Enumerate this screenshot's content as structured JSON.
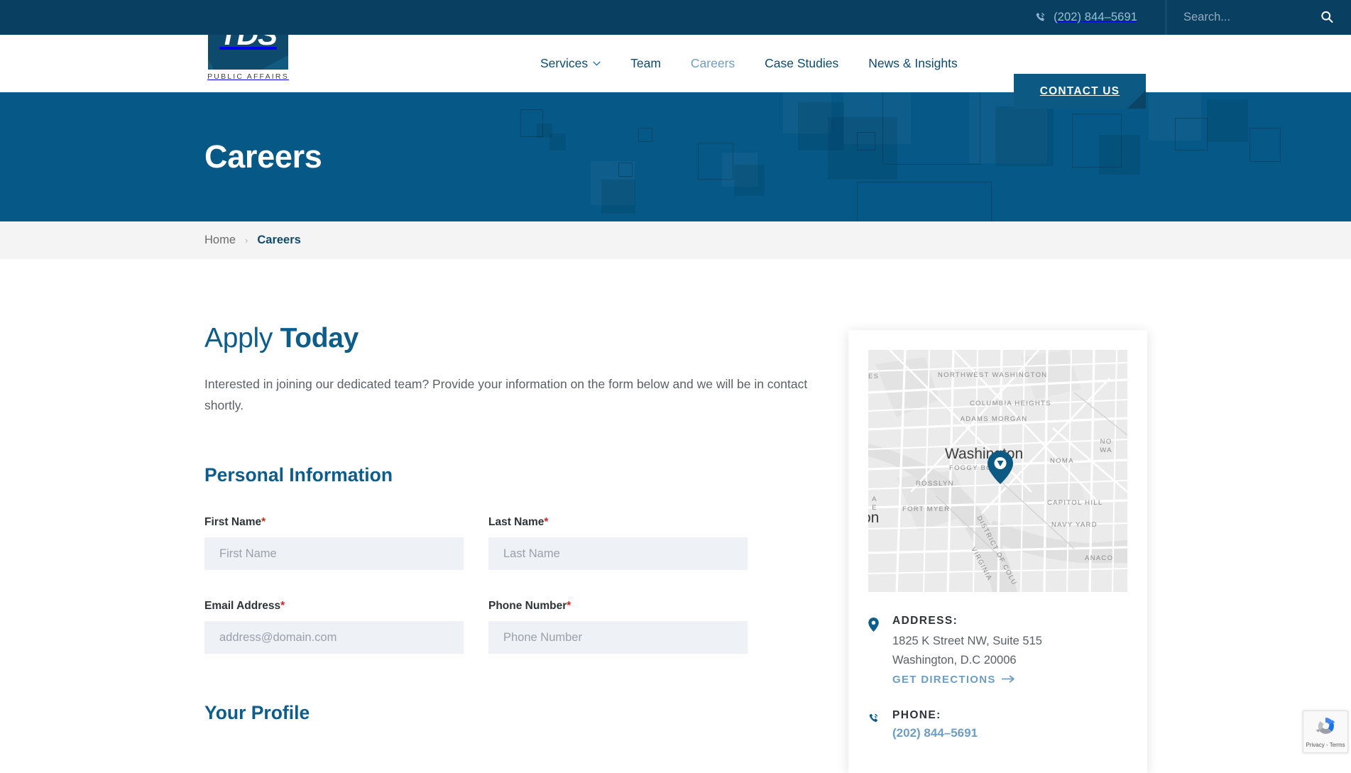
{
  "topbar": {
    "phone_icon": "phone-ringing-icon",
    "phone": "(202) 844–5691",
    "search_placeholder": "Search...",
    "search_value": "",
    "search_icon": "search-icon"
  },
  "logo": {
    "letters": "TDS",
    "subtitle": "PUBLIC AFFAIRS"
  },
  "nav": {
    "items": [
      {
        "label": "Services",
        "active": false,
        "has_caret": true
      },
      {
        "label": "Team",
        "active": false,
        "has_caret": false
      },
      {
        "label": "Careers",
        "active": true,
        "has_caret": false
      },
      {
        "label": "Case Studies",
        "active": false,
        "has_caret": false
      },
      {
        "label": "News & Insights",
        "active": false,
        "has_caret": false
      }
    ],
    "contact_label": "CONTACT US"
  },
  "hero": {
    "title": "Careers"
  },
  "breadcrumb": {
    "home": "Home",
    "separator": "›",
    "current": "Careers"
  },
  "main": {
    "heading_light": "Apply ",
    "heading_bold": "Today",
    "intro": "Interested in joining our dedicated team? Provide your information on the form below and we will be in contact shortly.",
    "personal_section": "Personal Information",
    "profile_section": "Your Profile",
    "fields": [
      {
        "label": "First Name",
        "required": true,
        "placeholder": "First Name",
        "value": ""
      },
      {
        "label": "Last Name",
        "required": true,
        "placeholder": "Last Name",
        "value": ""
      },
      {
        "label": "Email Address",
        "required": true,
        "placeholder": "address@domain.com",
        "value": ""
      },
      {
        "label": "Phone Number",
        "required": true,
        "placeholder": "Phone Number",
        "value": ""
      }
    ],
    "required_marker": "*"
  },
  "sidebar": {
    "map": {
      "city": "Washington",
      "neighborhoods": [
        "NORTHWEST WASHINGTON",
        "COLUMBIA HEIGHTS",
        "ADAMS MORGAN",
        "FOGGY BO",
        "ROSSLYN",
        "FORT MYER",
        "NOMA",
        "CAPITOL HILL",
        "NAVY YARD",
        "DISTRICT OF COLU",
        "VIRGINIA",
        "ANACO",
        "NO WA",
        "ES",
        "A E",
        "on"
      ],
      "pin_icon": "map-pin-icon"
    },
    "address": {
      "icon": "location-pin-icon",
      "title": "ADDRESS:",
      "line1": "1825 K Street NW, Suite 515",
      "line2": "Washington, D.C 20006",
      "directions_label": "GET DIRECTIONS",
      "directions_arrow": "→"
    },
    "phone": {
      "icon": "phone-ringing-icon",
      "title": "PHONE:",
      "number": "(202) 844–5691"
    }
  },
  "recaptcha": {
    "label": "Privacy - Terms",
    "icon": "recaptcha-icon"
  },
  "colors": {
    "topbar": "#093f60",
    "hero": "#065886",
    "accent": "#0d5c8a",
    "link_light": "#6f9dc0",
    "button": "#0c5a84",
    "required": "#e02020",
    "input_bg": "#eef1f6",
    "breadcrumb_bg": "#f4f4f4"
  }
}
